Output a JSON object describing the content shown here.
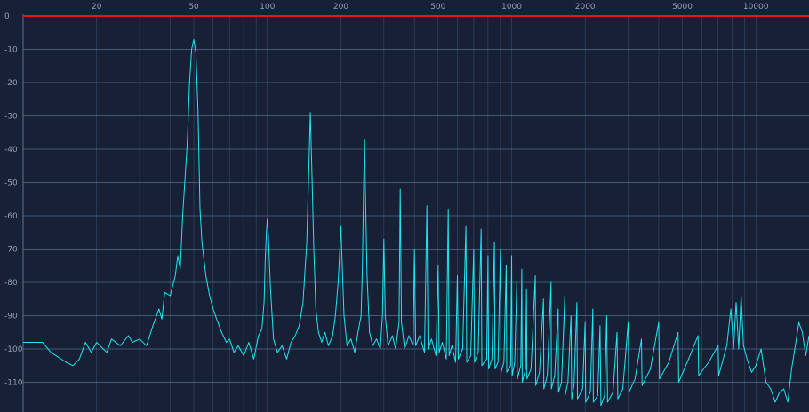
{
  "chart_data": {
    "type": "line",
    "x_scale": "log",
    "xlim": [
      10,
      16500
    ],
    "ylim": [
      -117,
      0
    ],
    "x_tick_labels": [
      "20",
      "50",
      "100",
      "200",
      "500",
      "1000",
      "2000",
      "5000",
      "10000"
    ],
    "x_tick_values": [
      20,
      50,
      100,
      200,
      500,
      1000,
      2000,
      5000,
      10000
    ],
    "y_tick_labels": [
      "0",
      "-10",
      "-20",
      "-30",
      "-40",
      "-50",
      "-60",
      "-70",
      "-80",
      "-90",
      "-100",
      "-110"
    ],
    "y_tick_values": [
      0,
      -10,
      -20,
      -30,
      -40,
      -50,
      -60,
      -70,
      -80,
      -90,
      -100,
      -110
    ],
    "grid": true,
    "colors": {
      "background": "#172035",
      "grid": "#5a7596",
      "trace": "#1fe7f0",
      "zero_line": "#e01818",
      "labels": "#8fa0b6"
    },
    "series": [
      {
        "points": [
          [
            10,
            -98
          ],
          [
            12,
            -98
          ],
          [
            13,
            -101
          ],
          [
            15,
            -104
          ],
          [
            16,
            -105
          ],
          [
            17,
            -103
          ],
          [
            18,
            -98
          ],
          [
            19,
            -101
          ],
          [
            20,
            -98
          ],
          [
            22,
            -101
          ],
          [
            23,
            -97
          ],
          [
            25,
            -99
          ],
          [
            27,
            -96
          ],
          [
            28,
            -98
          ],
          [
            30,
            -97
          ],
          [
            32,
            -99
          ],
          [
            34,
            -93
          ],
          [
            36,
            -88
          ],
          [
            37,
            -91
          ],
          [
            38,
            -83
          ],
          [
            40,
            -84
          ],
          [
            42,
            -78
          ],
          [
            43,
            -72
          ],
          [
            44,
            -76
          ],
          [
            45,
            -60
          ],
          [
            47,
            -38
          ],
          [
            48,
            -20
          ],
          [
            49,
            -10
          ],
          [
            50,
            -7
          ],
          [
            51,
            -11
          ],
          [
            52,
            -28
          ],
          [
            53,
            -58
          ],
          [
            54,
            -68
          ],
          [
            56,
            -78
          ],
          [
            58,
            -84
          ],
          [
            60,
            -88
          ],
          [
            62,
            -91
          ],
          [
            65,
            -95
          ],
          [
            68,
            -98
          ],
          [
            70,
            -97
          ],
          [
            73,
            -101
          ],
          [
            76,
            -99
          ],
          [
            80,
            -102
          ],
          [
            84,
            -98
          ],
          [
            88,
            -103
          ],
          [
            92,
            -96
          ],
          [
            95,
            -94
          ],
          [
            97,
            -86
          ],
          [
            98,
            -74
          ],
          [
            99,
            -66
          ],
          [
            100,
            -61
          ],
          [
            101,
            -66
          ],
          [
            103,
            -82
          ],
          [
            106,
            -97
          ],
          [
            110,
            -101
          ],
          [
            115,
            -99
          ],
          [
            120,
            -103
          ],
          [
            125,
            -98
          ],
          [
            130,
            -96
          ],
          [
            135,
            -93
          ],
          [
            140,
            -86
          ],
          [
            145,
            -68
          ],
          [
            148,
            -45
          ],
          [
            150,
            -29
          ],
          [
            152,
            -45
          ],
          [
            155,
            -70
          ],
          [
            158,
            -88
          ],
          [
            162,
            -95
          ],
          [
            167,
            -98
          ],
          [
            172,
            -95
          ],
          [
            178,
            -99
          ],
          [
            185,
            -96
          ],
          [
            190,
            -90
          ],
          [
            195,
            -80
          ],
          [
            198,
            -70
          ],
          [
            200,
            -63
          ],
          [
            202,
            -72
          ],
          [
            206,
            -90
          ],
          [
            212,
            -99
          ],
          [
            220,
            -97
          ],
          [
            228,
            -101
          ],
          [
            235,
            -95
          ],
          [
            242,
            -90
          ],
          [
            245,
            -75
          ],
          [
            248,
            -50
          ],
          [
            250,
            -37
          ],
          [
            252,
            -52
          ],
          [
            256,
            -78
          ],
          [
            262,
            -95
          ],
          [
            270,
            -99
          ],
          [
            280,
            -97
          ],
          [
            290,
            -100
          ],
          [
            296,
            -90
          ],
          [
            300,
            -67
          ],
          [
            304,
            -90
          ],
          [
            312,
            -99
          ],
          [
            325,
            -96
          ],
          [
            335,
            -100
          ],
          [
            346,
            -92
          ],
          [
            350,
            -52
          ],
          [
            354,
            -92
          ],
          [
            365,
            -100
          ],
          [
            380,
            -96
          ],
          [
            395,
            -99
          ],
          [
            400,
            -70
          ],
          [
            405,
            -99
          ],
          [
            420,
            -96
          ],
          [
            440,
            -101
          ],
          [
            450,
            -57
          ],
          [
            455,
            -100
          ],
          [
            470,
            -97
          ],
          [
            490,
            -102
          ],
          [
            500,
            -75
          ],
          [
            505,
            -101
          ],
          [
            520,
            -98
          ],
          [
            540,
            -103
          ],
          [
            550,
            -58
          ],
          [
            555,
            -102
          ],
          [
            570,
            -99
          ],
          [
            590,
            -104
          ],
          [
            600,
            -78
          ],
          [
            605,
            -103
          ],
          [
            630,
            -100
          ],
          [
            650,
            -63
          ],
          [
            655,
            -104
          ],
          [
            680,
            -102
          ],
          [
            700,
            -70
          ],
          [
            705,
            -104
          ],
          [
            730,
            -101
          ],
          [
            750,
            -64
          ],
          [
            755,
            -105
          ],
          [
            790,
            -103
          ],
          [
            800,
            -72
          ],
          [
            805,
            -106
          ],
          [
            830,
            -103
          ],
          [
            850,
            -68
          ],
          [
            855,
            -106
          ],
          [
            880,
            -104
          ],
          [
            900,
            -70
          ],
          [
            905,
            -107
          ],
          [
            930,
            -104
          ],
          [
            950,
            -75
          ],
          [
            955,
            -107
          ],
          [
            990,
            -105
          ],
          [
            1000,
            -72
          ],
          [
            1005,
            -108
          ],
          [
            1030,
            -104
          ],
          [
            1050,
            -80
          ],
          [
            1055,
            -109
          ],
          [
            1090,
            -105
          ],
          [
            1100,
            -76
          ],
          [
            1105,
            -110
          ],
          [
            1140,
            -106
          ],
          [
            1150,
            -82
          ],
          [
            1155,
            -109
          ],
          [
            1200,
            -106
          ],
          [
            1250,
            -78
          ],
          [
            1255,
            -111
          ],
          [
            1300,
            -107
          ],
          [
            1350,
            -85
          ],
          [
            1355,
            -112
          ],
          [
            1400,
            -108
          ],
          [
            1450,
            -80
          ],
          [
            1455,
            -112
          ],
          [
            1500,
            -108
          ],
          [
            1550,
            -88
          ],
          [
            1555,
            -113
          ],
          [
            1600,
            -110
          ],
          [
            1650,
            -84
          ],
          [
            1655,
            -114
          ],
          [
            1700,
            -110
          ],
          [
            1750,
            -90
          ],
          [
            1760,
            -115
          ],
          [
            1800,
            -111
          ],
          [
            1850,
            -86
          ],
          [
            1860,
            -115
          ],
          [
            1950,
            -112
          ],
          [
            2000,
            -92
          ],
          [
            2010,
            -116
          ],
          [
            2100,
            -113
          ],
          [
            2150,
            -88
          ],
          [
            2160,
            -116
          ],
          [
            2250,
            -114
          ],
          [
            2300,
            -93
          ],
          [
            2320,
            -117
          ],
          [
            2400,
            -114
          ],
          [
            2450,
            -90
          ],
          [
            2470,
            -116
          ],
          [
            2600,
            -113
          ],
          [
            2700,
            -95
          ],
          [
            2720,
            -115
          ],
          [
            2850,
            -112
          ],
          [
            3000,
            -92
          ],
          [
            3020,
            -113
          ],
          [
            3200,
            -109
          ],
          [
            3400,
            -97
          ],
          [
            3420,
            -111
          ],
          [
            3700,
            -106
          ],
          [
            4000,
            -92
          ],
          [
            4030,
            -109
          ],
          [
            4400,
            -104
          ],
          [
            4800,
            -95
          ],
          [
            4830,
            -110
          ],
          [
            5300,
            -103
          ],
          [
            5800,
            -96
          ],
          [
            5830,
            -108
          ],
          [
            6400,
            -104
          ],
          [
            7000,
            -99
          ],
          [
            7040,
            -108
          ],
          [
            7600,
            -99
          ],
          [
            7900,
            -88
          ],
          [
            8100,
            -100
          ],
          [
            8300,
            -86
          ],
          [
            8500,
            -100
          ],
          [
            8700,
            -84
          ],
          [
            8900,
            -99
          ],
          [
            9200,
            -103
          ],
          [
            9600,
            -107
          ],
          [
            10000,
            -105
          ],
          [
            10500,
            -100
          ],
          [
            11000,
            -110
          ],
          [
            11500,
            -112
          ],
          [
            12000,
            -116
          ],
          [
            12500,
            -113
          ],
          [
            13000,
            -112
          ],
          [
            13500,
            -116
          ],
          [
            14000,
            -106
          ],
          [
            14500,
            -99
          ],
          [
            15000,
            -92
          ],
          [
            15500,
            -95
          ],
          [
            16000,
            -102
          ],
          [
            16500,
            -96
          ]
        ]
      }
    ]
  }
}
